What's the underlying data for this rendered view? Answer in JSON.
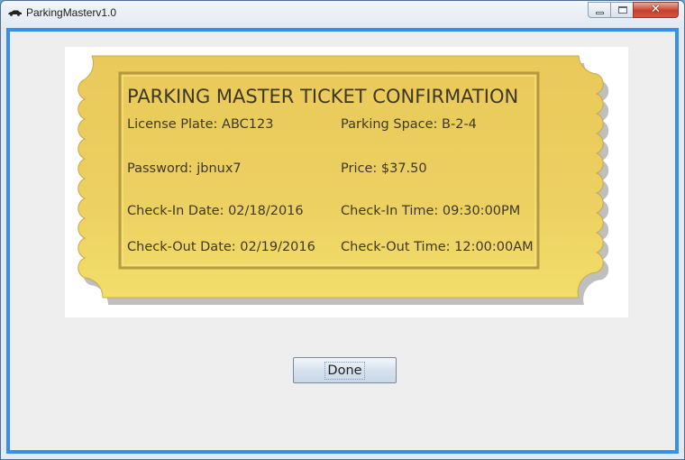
{
  "window": {
    "title": "ParkingMasterv1.0",
    "icon": "car-icon",
    "controls": [
      "minimize-icon",
      "maximize-icon",
      "close-icon"
    ]
  },
  "ticket": {
    "heading": "PARKING MASTER TICKET CONFIRMATION",
    "license_plate": "License Plate: ABC123",
    "parking_space": "Parking Space: B-2-4",
    "password": "Password: jbnux7",
    "price": "Price: $37.50",
    "check_in_date": "Check-In Date: 02/18/2016",
    "check_in_time": "Check-In Time: 09:30:00PM",
    "check_out_date": "Check-Out Date: 02/19/2016",
    "check_out_time": "Check-Out Time: 12:00:00AM"
  },
  "done_label": "Done",
  "colors": {
    "ticket_gold": "#f0d462",
    "frame_blue": "#3b8ee5",
    "client_bg": "#eeeeee"
  }
}
